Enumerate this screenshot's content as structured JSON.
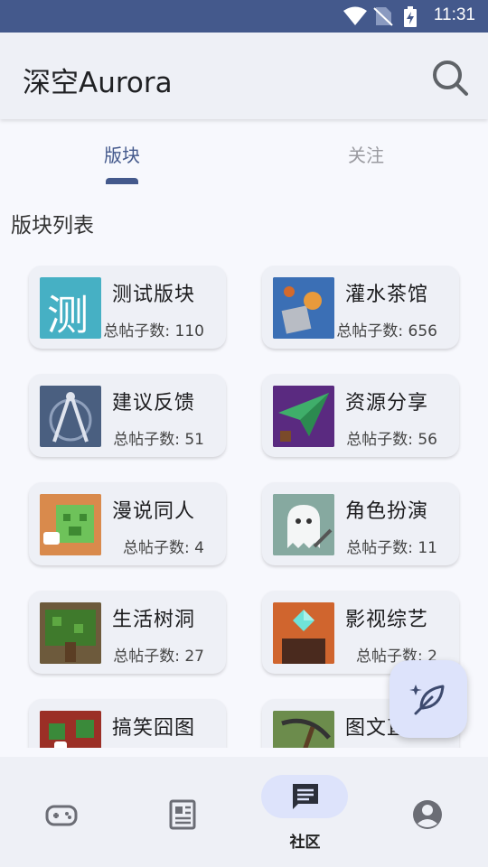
{
  "status_bar": {
    "time": "11:31"
  },
  "app_bar": {
    "title": "深空Aurora",
    "search_icon": "search-icon"
  },
  "tabs": [
    {
      "label": "版块",
      "active": true
    },
    {
      "label": "关注",
      "active": false
    }
  ],
  "section_title": "版块列表",
  "boards": [
    {
      "name": "测试版块",
      "count": "总帖子数: 110",
      "thumb_char": "测"
    },
    {
      "name": "灌水茶馆",
      "count": "总帖子数: 656"
    },
    {
      "name": "建议反馈",
      "count": "总帖子数: 51"
    },
    {
      "name": "资源分享",
      "count": "总帖子数: 56"
    },
    {
      "name": "漫说同人",
      "count": "总帖子数: 4"
    },
    {
      "name": "角色扮演",
      "count": "总帖子数: 11"
    },
    {
      "name": "生活树洞",
      "count": "总帖子数: 27"
    },
    {
      "name": "影视综艺",
      "count": "总帖子数: 2"
    },
    {
      "name": "搞笑囧图",
      "count": ""
    },
    {
      "name": "图文直",
      "count": ""
    }
  ],
  "fab": {
    "icon": "feather-icon"
  },
  "bottom_nav": [
    {
      "icon": "gamepad-icon",
      "label": ""
    },
    {
      "icon": "newspaper-icon",
      "label": ""
    },
    {
      "icon": "chat-icon",
      "label": "社区",
      "active": true
    },
    {
      "icon": "account-icon",
      "label": ""
    }
  ],
  "colors": {
    "primary": "#44598c",
    "surface": "#eef0f6",
    "accent_container": "#dde3fb"
  }
}
